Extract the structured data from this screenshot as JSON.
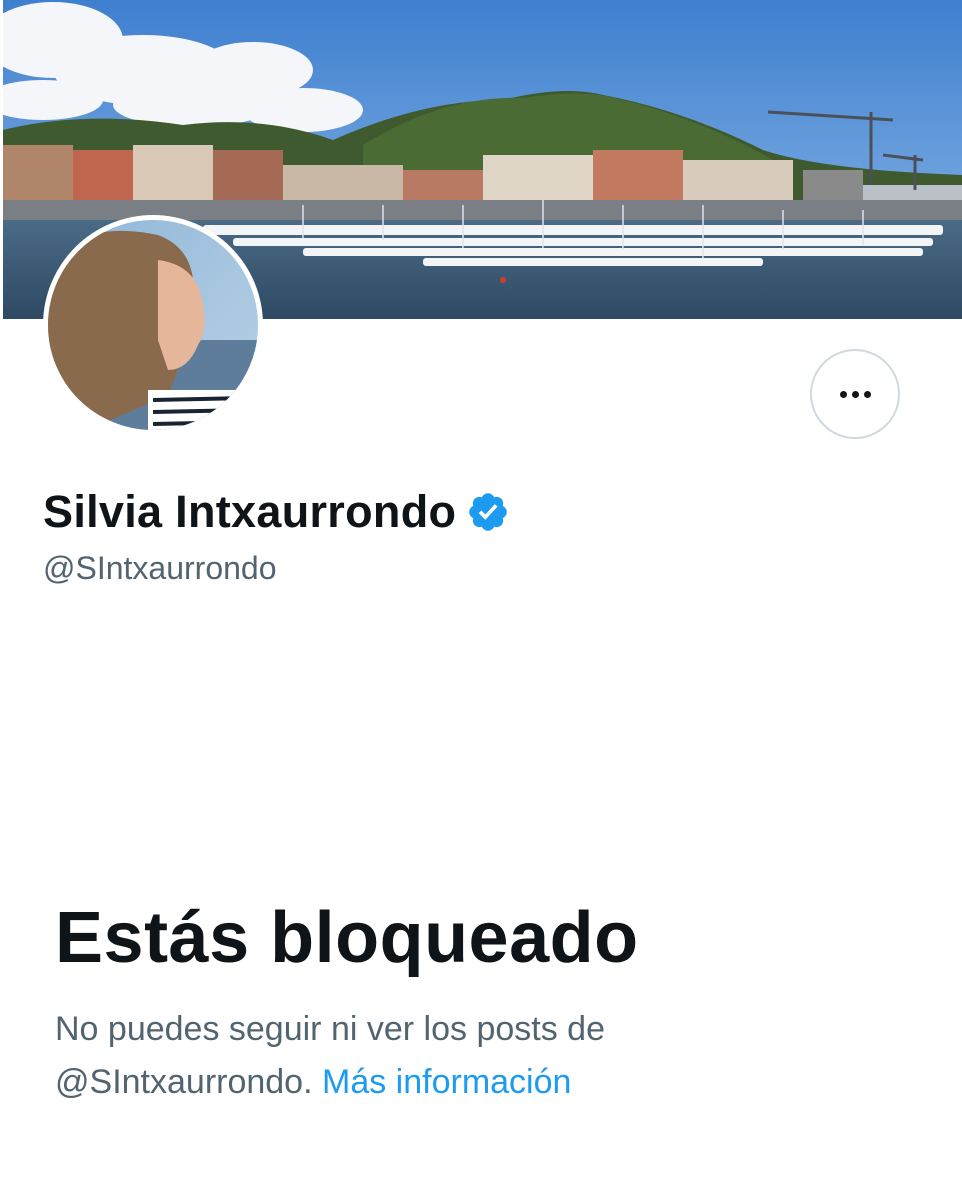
{
  "profile": {
    "display_name": "Silvia Intxaurrondo",
    "handle": "@SIntxaurrondo",
    "verified": true,
    "verified_color": "#1d9bf0",
    "banner_icon": "harbor-landscape-photo",
    "avatar_icon": "profile-photo"
  },
  "actions": {
    "more_icon": "ellipsis-icon"
  },
  "blocked": {
    "title": "Estás bloqueado",
    "message_line1": "No puedes seguir ni ver los posts de",
    "message_handle": "@SIntxaurrondo.",
    "learn_more": "Más información"
  },
  "colors": {
    "text_primary": "#0f1419",
    "text_secondary": "#536471",
    "link": "#1d9bf0",
    "border": "#cfd9de"
  }
}
